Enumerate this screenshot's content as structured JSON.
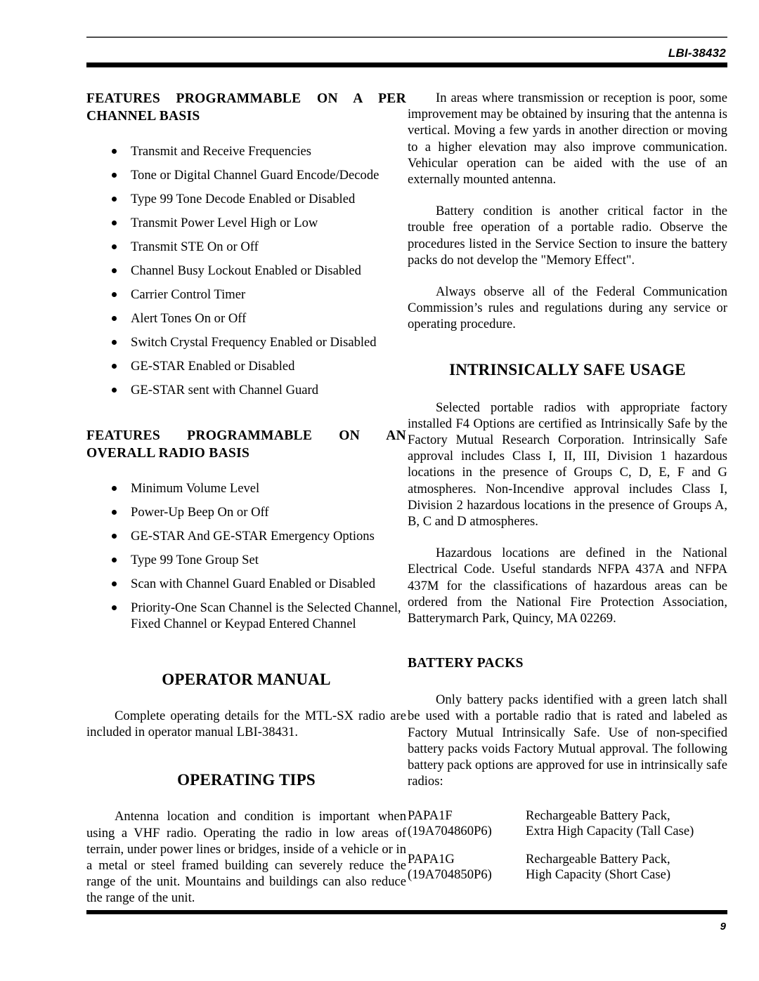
{
  "header": {
    "document_id": "LBI-38432"
  },
  "footer": {
    "page_number": "9"
  },
  "left_column": {
    "heading_per_channel": "FEATURES PROGRAMMABLE ON A PER CHANNEL BASIS",
    "per_channel_features": [
      "Transmit and Receive Frequencies",
      "Tone or Digital Channel Guard Encode/Decode",
      "Type 99 Tone Decode Enabled or Disabled",
      "Transmit Power Level High or Low",
      "Transmit STE On or Off",
      "Channel Busy Lockout Enabled or Disabled",
      "Carrier Control Timer",
      "Alert Tones On or Off",
      "Switch Crystal Frequency Enabled or Disabled",
      "GE-STAR Enabled or Disabled",
      "GE-STAR sent with Channel Guard"
    ],
    "heading_overall_radio": "FEATURES PROGRAMMABLE ON AN OVERALL RADIO BASIS",
    "overall_radio_features": [
      "Minimum Volume Level",
      "Power-Up Beep On or Off",
      "GE-STAR And GE-STAR Emergency Options",
      "Type 99 Tone Group Set",
      "Scan with Channel Guard Enabled or Disabled",
      "Priority-One Scan Channel is the Selected Channel, Fixed Channel or Keypad Entered Channel"
    ],
    "heading_operator_manual": "OPERATOR MANUAL",
    "operator_manual_paragraph": "Complete operating details for the MTL-SX radio are included in operator manual LBI-38431.",
    "heading_operating_tips": "OPERATING TIPS",
    "operating_tips_paragraph": "Antenna location and condition is important when using a VHF radio. Operating the radio in low areas of terrain, under power lines or bridges, inside of a vehicle or in a metal or steel framed building can severely reduce the range of the unit. Mountains and buildings can also reduce the range of the unit."
  },
  "right_column": {
    "paragraph_antenna": "In areas where transmission or reception is poor, some improvement may be obtained by insuring that the antenna is vertical. Moving a few yards in another direction or moving to a higher elevation may also improve communication. Vehicular operation can be aided with the use of an externally mounted antenna.",
    "paragraph_battery_condition": "Battery condition is another critical factor in the trouble free operation of a portable radio. Observe the procedures listed in the Service Section to insure the battery packs do not develop the \"Memory Effect\".",
    "paragraph_fcc": "Always observe all of the Federal Communication Commission’s rules and regulations during any service or operating procedure.",
    "heading_intrinsically_safe": "INTRINSICALLY SAFE USAGE",
    "paragraph_intrinsically_safe": "Selected portable radios with appropriate factory installed F4 Options are certified as Intrinsically Safe by the Factory Mutual Research Corporation. Intrinsically Safe approval includes Class I, II, III, Division 1 hazardous locations in the presence of Groups C, D, E, F and G atmospheres. Non-Incendive approval includes Class I, Division 2 hazardous locations in the presence of Groups A, B, C and D atmospheres.",
    "paragraph_hazardous_locations": "Hazardous locations are defined in the National Electrical Code. Useful standards NFPA 437A and NFPA 437M for the classifications of hazardous areas can be ordered from the National Fire Protection Association, Batterymarch Park, Quincy, MA 02269.",
    "heading_battery_packs": "BATTERY PACKS",
    "paragraph_battery_packs": "Only battery packs identified with a green latch shall be used with a portable radio that is rated and labeled as Factory Mutual Intrinsically Safe. Use of non-specified battery packs voids Factory Mutual approval. The following battery pack options are approved for use in intrinsically safe radios:",
    "battery_options": [
      {
        "model": "PAPA1F",
        "part_number": "(19A704860P6)",
        "description_line1": "Rechargeable Battery Pack,",
        "description_line2": "Extra High Capacity (Tall Case)"
      },
      {
        "model": "PAPA1G",
        "part_number": "(19A704850P6)",
        "description_line1": "Rechargeable Battery Pack,",
        "description_line2": "High Capacity (Short Case)"
      }
    ]
  }
}
